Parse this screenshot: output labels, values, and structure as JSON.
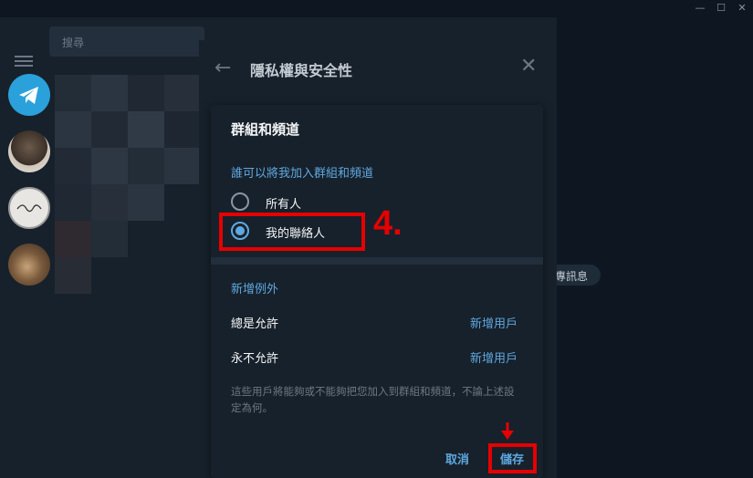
{
  "window": {
    "minimize_glyph": "—",
    "maximize_glyph": "☐",
    "close_glyph": "✕"
  },
  "search": {
    "placeholder": "搜尋"
  },
  "privacy_panel": {
    "title": "隱私權與安全性",
    "back_icon": "arrow-left-icon",
    "close_icon": "close-icon"
  },
  "background_chat": {
    "pill_text": "專訊息"
  },
  "dialog": {
    "title": "群組和頻道",
    "who_can_label": "誰可以將我加入群組和頻道",
    "options": [
      {
        "label": "所有人",
        "selected": false
      },
      {
        "label": "我的聯絡人",
        "selected": true
      }
    ],
    "exceptions_label": "新增例外",
    "always_allow": {
      "label": "總是允許",
      "action": "新增用戶"
    },
    "never_allow": {
      "label": "永不允許",
      "action": "新增用戶"
    },
    "note": "這些用戶將能夠或不能夠把您加入到群組和頻道，不論上述設定為何。",
    "cancel_label": "取消",
    "save_label": "儲存"
  },
  "annotation": {
    "step_label": "4."
  },
  "colors": {
    "accent": "#5fa8e0",
    "highlight": "#e60000",
    "background": "#17212b"
  }
}
